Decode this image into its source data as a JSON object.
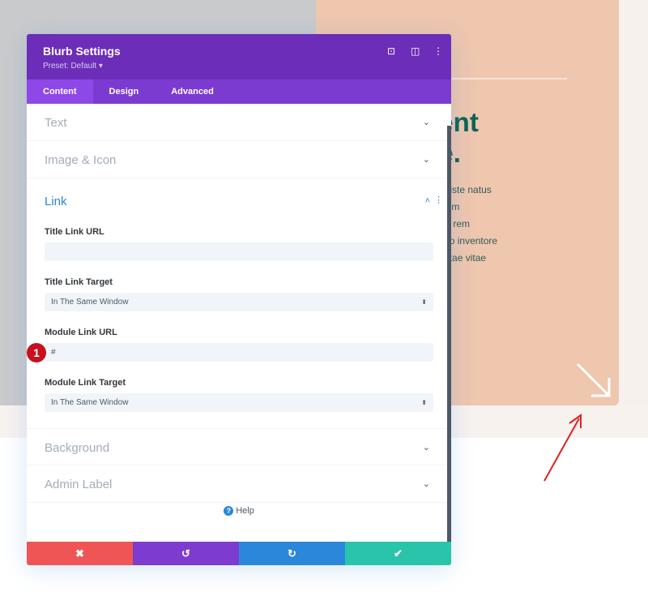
{
  "background": {
    "heading": "ontent\nhere.",
    "body": "unde omnis iste natus\nn accusantium\nntium, totam rem\na quae ab illo inventore\nchitecto beatae vitae\no."
  },
  "modal": {
    "title": "Blurb Settings",
    "preset": "Preset: Default ▾",
    "tabs": [
      {
        "label": "Content",
        "active": true
      },
      {
        "label": "Design"
      },
      {
        "label": "Advanced"
      }
    ],
    "sections": {
      "text": "Text",
      "image_icon": "Image & Icon",
      "link": "Link",
      "background": "Background",
      "admin_label": "Admin Label"
    },
    "fields": {
      "title_link_url_label": "Title Link URL",
      "title_link_url_value": "",
      "title_link_target_label": "Title Link Target",
      "title_link_target_value": "In The Same Window",
      "module_link_url_label": "Module Link URL",
      "module_link_url_value": "#",
      "module_link_target_label": "Module Link Target",
      "module_link_target_value": "In The Same Window"
    },
    "badge": "1",
    "help": "Help"
  },
  "colors": {
    "header": "#6c2eb9",
    "tabs": "#7b3bd0",
    "cancel": "#ef5555",
    "undo": "#7e3bd0",
    "redo": "#2b87da",
    "save": "#29c4a9",
    "heading": "#0d6457"
  }
}
